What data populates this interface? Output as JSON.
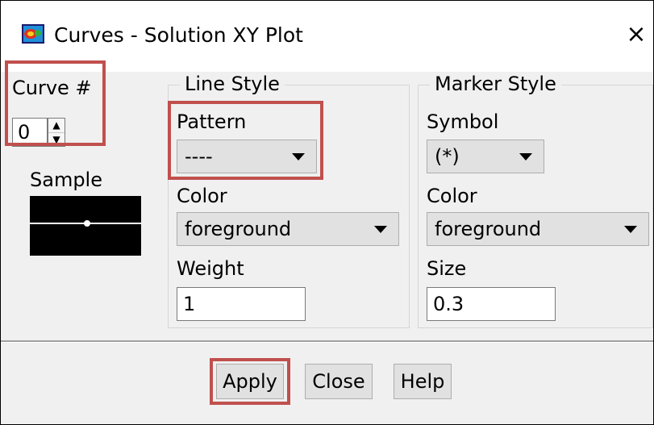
{
  "window": {
    "title": "Curves - Solution XY Plot",
    "close_glyph": "×",
    "app_icon": "fluent-app-icon"
  },
  "curve": {
    "label": "Curve #",
    "value": "0",
    "up_glyph": "▲",
    "down_glyph": "▼"
  },
  "sample": {
    "label": "Sample"
  },
  "line_style": {
    "group_label": "Line Style",
    "pattern_label": "Pattern",
    "pattern_value": "----",
    "color_label": "Color",
    "color_value": "foreground",
    "weight_label": "Weight",
    "weight_value": "1"
  },
  "marker_style": {
    "group_label": "Marker Style",
    "symbol_label": "Symbol",
    "symbol_value": "(*)",
    "color_label": "Color",
    "color_value": "foreground",
    "size_label": "Size",
    "size_value": "0.3"
  },
  "buttons": {
    "apply": "Apply",
    "close": "Close",
    "help": "Help"
  },
  "colors": {
    "highlight": "#c0504d",
    "dialog_bg": "#f0f0f0",
    "sample_bg": "#000000",
    "sample_line": "#ffffff"
  }
}
